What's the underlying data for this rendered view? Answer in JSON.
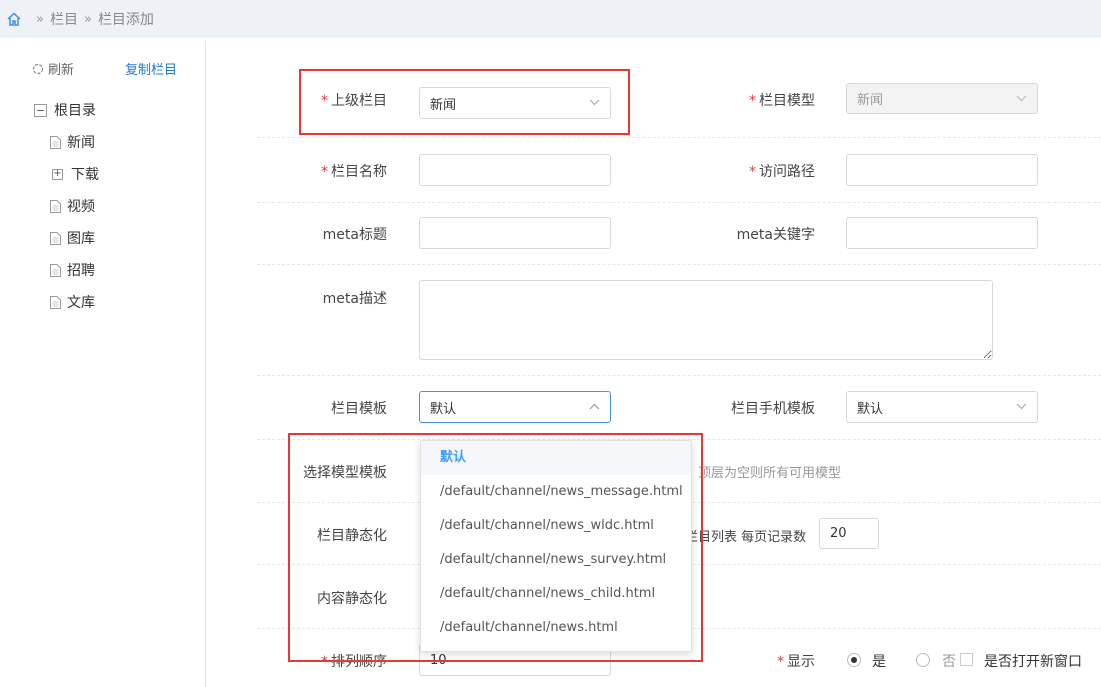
{
  "breadcrumb": {
    "items": [
      "栏目",
      "栏目添加"
    ],
    "separator": "»"
  },
  "sidebar": {
    "refresh_label": "刷新",
    "copy_label": "复制栏目",
    "root": {
      "label": "根目录",
      "toggle": "−"
    },
    "items": [
      {
        "label": "新闻",
        "type": "doc"
      },
      {
        "label": "下载",
        "type": "folder",
        "toggle": "+"
      },
      {
        "label": "视频",
        "type": "doc"
      },
      {
        "label": "图库",
        "type": "doc"
      },
      {
        "label": "招聘",
        "type": "doc"
      },
      {
        "label": "文库",
        "type": "doc"
      }
    ]
  },
  "form": {
    "required_mark": "*",
    "parent_column": {
      "label": "上级栏目",
      "value": "新闻"
    },
    "column_model": {
      "label": "栏目模型",
      "value": "新闻"
    },
    "column_name": {
      "label": "栏目名称",
      "value": ""
    },
    "access_path": {
      "label": "访问路径",
      "value": ""
    },
    "meta_title": {
      "label": "meta标题",
      "value": ""
    },
    "meta_keywords": {
      "label": "meta关键字",
      "value": ""
    },
    "meta_description": {
      "label": "meta描述",
      "value": ""
    },
    "column_template": {
      "label": "栏目模板",
      "value": "默认"
    },
    "mobile_template": {
      "label": "栏目手机模板",
      "value": "默认"
    },
    "select_model_template": {
      "label": "选择模型模板",
      "hint": "，顶层为空则所有可用模型"
    },
    "column_static": {
      "label": "栏目静态化",
      "hint": "栏目列表  每页记录数",
      "per_page": "20"
    },
    "content_static": {
      "label": "内容静态化"
    },
    "sort_order": {
      "label": "排列顺序",
      "value": "10"
    },
    "display": {
      "label": "显示",
      "yes": "是",
      "no": "否",
      "selected": "是"
    },
    "new_window": {
      "label": "是否打开新窗口",
      "checked": false
    }
  },
  "template_dropdown": {
    "selected": "默认",
    "options": [
      "默认",
      "/default/channel/news_message.html",
      "/default/channel/news_wldc.html",
      "/default/channel/news_survey.html",
      "/default/channel/news_child.html",
      "/default/channel/news.html"
    ]
  },
  "colors": {
    "accent": "#409eff",
    "link": "#1e7ad6",
    "required": "#e4393c",
    "highlight_box": "#e53935"
  }
}
